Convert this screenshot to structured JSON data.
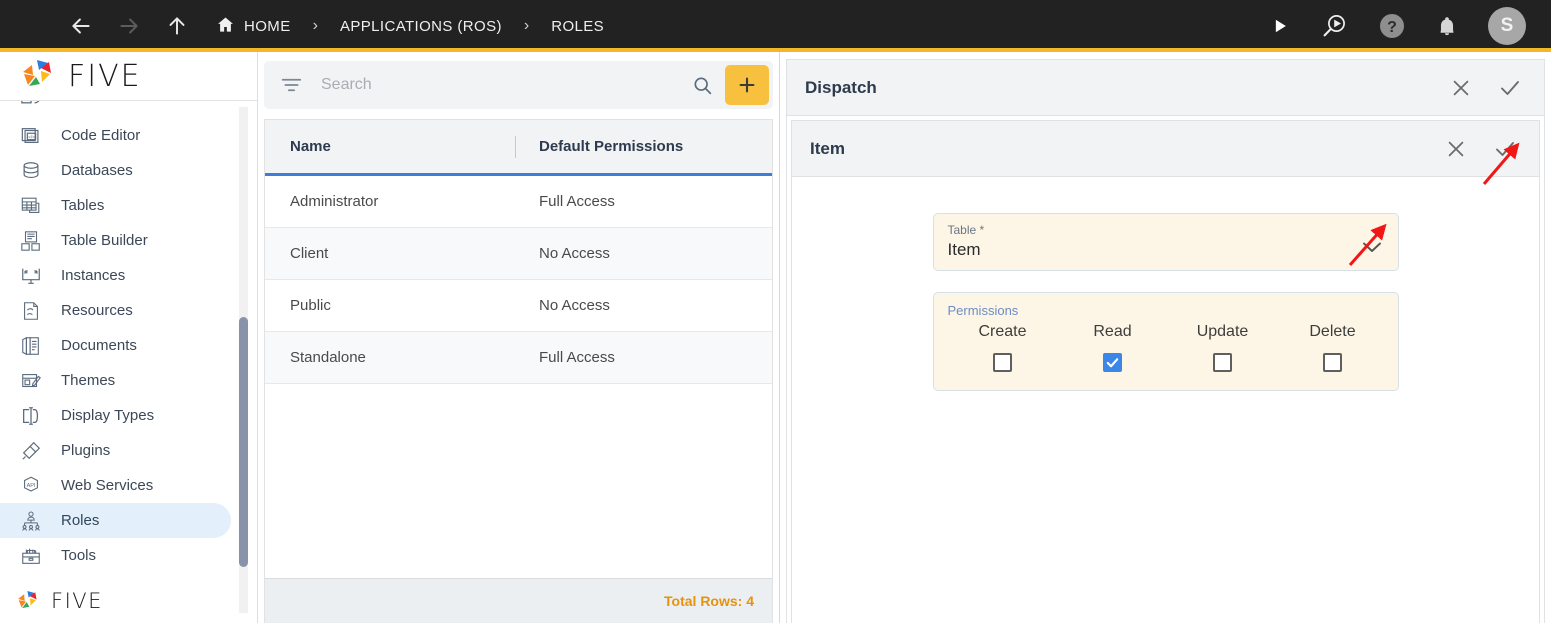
{
  "topbar": {
    "menu_icon": "hamburger-menu-icon",
    "back_icon": "back-arrow-icon",
    "forward_icon": "forward-arrow-icon",
    "up_icon": "up-arrow-icon",
    "home_icon": "home-icon",
    "breadcrumbs": [
      {
        "label": "HOME",
        "icon": "home-icon"
      },
      {
        "label": "APPLICATIONS (ROS)",
        "icon": ""
      },
      {
        "label": "ROLES",
        "icon": ""
      }
    ],
    "separator": "›",
    "actions": [
      {
        "name": "run-icon",
        "title": "Run"
      },
      {
        "name": "preview-run-icon",
        "title": "Preview"
      },
      {
        "name": "help-icon",
        "title": "Help"
      },
      {
        "name": "notifications-bell-icon",
        "title": "Notifications"
      }
    ],
    "avatar_initial": "S",
    "bar_color": "#222222",
    "accent_color": "#F2B829"
  },
  "sidebar": {
    "logo_text": "FIVE",
    "footer_logo_text": "FIVE",
    "items": [
      {
        "label": "",
        "icon": "partial-cut-icon",
        "active": false
      },
      {
        "label": "Code Editor",
        "icon": "code-editor-icon",
        "active": false
      },
      {
        "label": "Databases",
        "icon": "database-icon",
        "active": false
      },
      {
        "label": "Tables",
        "icon": "table-icon",
        "active": false
      },
      {
        "label": "Table Builder",
        "icon": "table-builder-icon",
        "active": false
      },
      {
        "label": "Instances",
        "icon": "instances-icon",
        "active": false
      },
      {
        "label": "Resources",
        "icon": "resources-icon",
        "active": false
      },
      {
        "label": "Documents",
        "icon": "documents-icon",
        "active": false
      },
      {
        "label": "Themes",
        "icon": "themes-icon",
        "active": false
      },
      {
        "label": "Display Types",
        "icon": "display-types-icon",
        "active": false
      },
      {
        "label": "Plugins",
        "icon": "plugins-icon",
        "active": false
      },
      {
        "label": "Web Services",
        "icon": "web-services-api-icon",
        "active": false
      },
      {
        "label": "Roles",
        "icon": "roles-icon",
        "active": true
      },
      {
        "label": "Tools",
        "icon": "tools-icon",
        "active": false
      }
    ]
  },
  "list_panel": {
    "search": {
      "placeholder": "Search",
      "value": "",
      "filter_icon": "filter-icon",
      "search_icon": "search-icon"
    },
    "add_button": {
      "label": "+",
      "icon": "plus-icon",
      "color": "#F7C03F"
    },
    "columns": [
      "Name",
      "Default Permissions"
    ],
    "rows": [
      {
        "name": "Administrator",
        "permissions": "Full Access"
      },
      {
        "name": "Client",
        "permissions": "No Access"
      },
      {
        "name": "Public",
        "permissions": "No Access"
      },
      {
        "name": "Standalone",
        "permissions": "Full Access"
      }
    ],
    "footer": {
      "total_rows_label": "Total Rows: 4",
      "color": "#E5930D"
    },
    "header_underline_color": "#3B7DD8"
  },
  "detail_panel": {
    "outer": {
      "title": "Dispatch",
      "close_icon": "close-x-icon",
      "confirm_icon": "checkmark-icon"
    },
    "inner": {
      "title": "Item",
      "close_icon": "close-x-icon",
      "confirm_icon": "checkmark-icon"
    },
    "form": {
      "table_field": {
        "label": "Table *",
        "value": "Item",
        "dropdown_icon": "chevron-down-icon"
      },
      "permissions": {
        "legend": "Permissions",
        "options": [
          {
            "label": "Create",
            "checked": false
          },
          {
            "label": "Read",
            "checked": true
          },
          {
            "label": "Update",
            "checked": false
          },
          {
            "label": "Delete",
            "checked": false
          }
        ],
        "checked_color": "#3B87E8"
      }
    },
    "field_bg": "#FDF6E6"
  },
  "annotations": {
    "arrow_color": "#F21616",
    "arrows": [
      {
        "name": "arrow-to-confirm-checkmark",
        "points_to": "inner-confirm-checkmark"
      },
      {
        "name": "arrow-to-table-dropdown",
        "points_to": "table-dropdown-chevron"
      }
    ]
  }
}
